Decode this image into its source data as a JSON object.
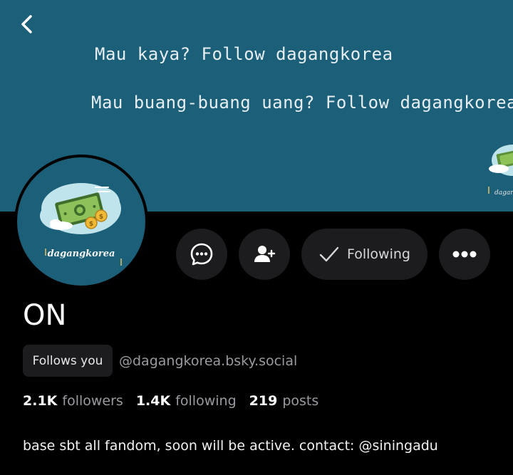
{
  "banner": {
    "line1": "Mau kaya? Follow dagangkorea",
    "line2": "Mau buang-buang uang? Follow dagangkorea",
    "color": "#1c5f79"
  },
  "nav": {
    "back_icon": "chevron-left-icon"
  },
  "avatar": {
    "logo_text": "dagangkorea"
  },
  "actions": {
    "message_icon": "chat-bubble-icon",
    "add_icon": "person-add-icon",
    "following_label": "Following",
    "more_icon": "ellipsis-icon"
  },
  "profile": {
    "display_name": "ON",
    "follows_you": "Follows you",
    "handle": "@dagangkorea.bsky.social",
    "bio": "base sbt all fandom, soon will be active. contact: @siningadu"
  },
  "stats": {
    "followers_count": "2.1K",
    "followers_label": "followers",
    "following_count": "1.4K",
    "following_label": "following",
    "posts_count": "219",
    "posts_label": "posts"
  }
}
